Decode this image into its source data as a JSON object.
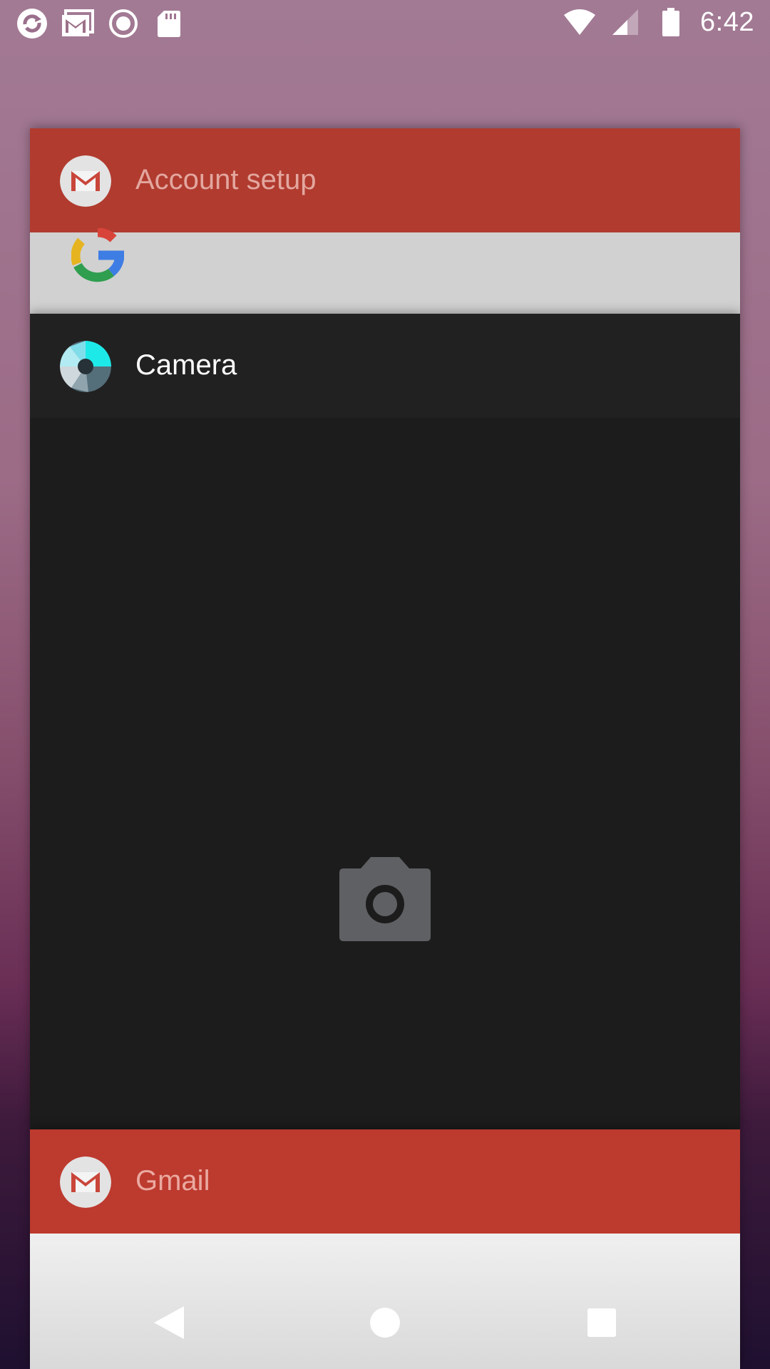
{
  "status_bar": {
    "time": "6:42",
    "left_icons": [
      "sync-icon",
      "gmail-notification-icon",
      "record-icon",
      "sd-card-icon"
    ],
    "right_icons": [
      "wifi-icon",
      "cellular-signal-icon",
      "battery-icon"
    ]
  },
  "recents": {
    "cards": [
      {
        "title": "Account setup",
        "icon": "gmail-icon",
        "header_color": "#b13b2f"
      },
      {
        "title": "Camera",
        "icon": "camera-app-icon",
        "header_color": "#212121"
      },
      {
        "title": "Gmail",
        "icon": "gmail-icon",
        "header_color": "#bd3a2e"
      }
    ]
  },
  "nav_bar": {
    "buttons": [
      "back-button",
      "home-button",
      "recents-button"
    ]
  }
}
